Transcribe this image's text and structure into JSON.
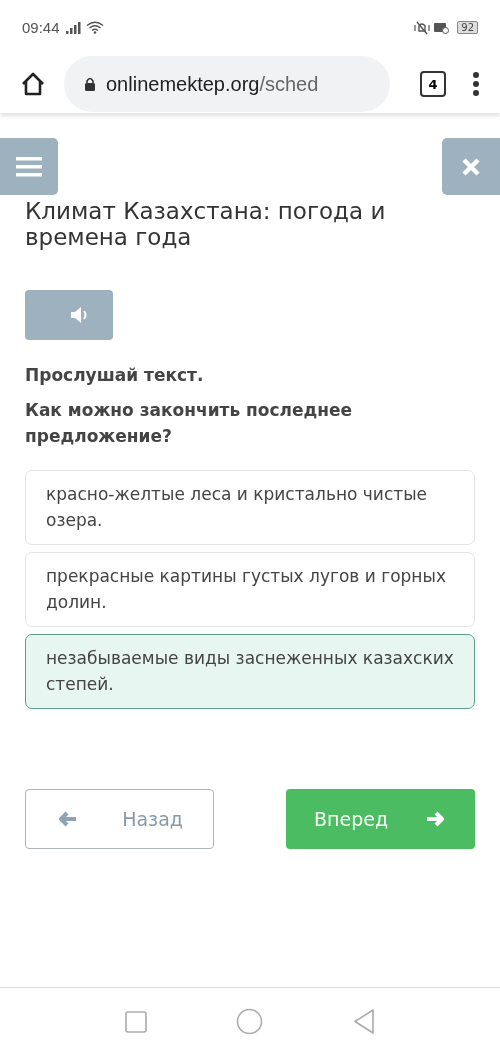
{
  "status_bar": {
    "time": "09:44",
    "battery": "92"
  },
  "browser": {
    "url_host": "onlinemektep.org",
    "url_path": "/sched",
    "tab_count": "4"
  },
  "lesson": {
    "title": "Климат Казахстана: погода и времена года"
  },
  "task": {
    "instruction": "Прослушай текст.",
    "question": "Как можно закончить последнее предложение?"
  },
  "options": [
    {
      "text": "красно-желтые леса и кристально чистые озера.",
      "selected": false
    },
    {
      "text": "прекрасные картины густых лугов и горных долин.",
      "selected": false
    },
    {
      "text": "незабываемые виды заснеженных казахских степей.",
      "selected": true
    }
  ],
  "navigation": {
    "back": "Назад",
    "next": "Вперед"
  }
}
